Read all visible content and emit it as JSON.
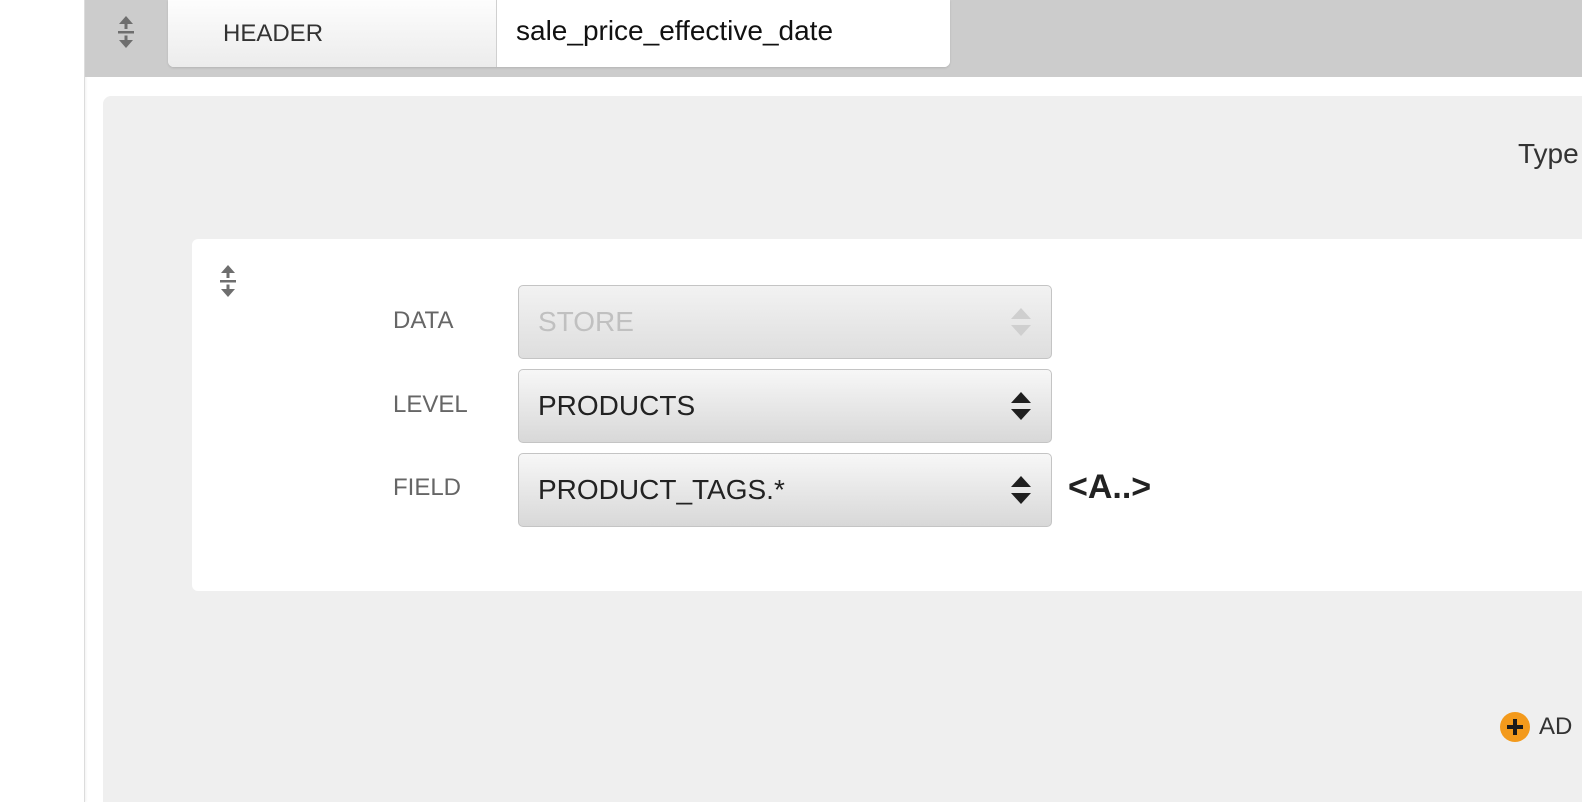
{
  "header": {
    "label": "HEADER",
    "value": "sale_price_effective_date"
  },
  "panel": {
    "type_label": "Type"
  },
  "rule": {
    "rows": [
      {
        "label": "DATA",
        "value": "STORE",
        "disabled": true
      },
      {
        "label": "LEVEL",
        "value": "PRODUCTS",
        "disabled": false
      },
      {
        "label": "FIELD",
        "value": "PRODUCT_TAGS.*",
        "disabled": false
      }
    ],
    "field_hint": "<A..>"
  },
  "add_button": {
    "label": "AD"
  },
  "icons": {
    "drag_handle": "drag-handle-icon",
    "select_arrows": "up-down-arrows-icon",
    "add": "plus-circle-icon"
  },
  "colors": {
    "accent": "#f39a1c",
    "top_bar": "#cccccc",
    "panel": "#efefef"
  }
}
